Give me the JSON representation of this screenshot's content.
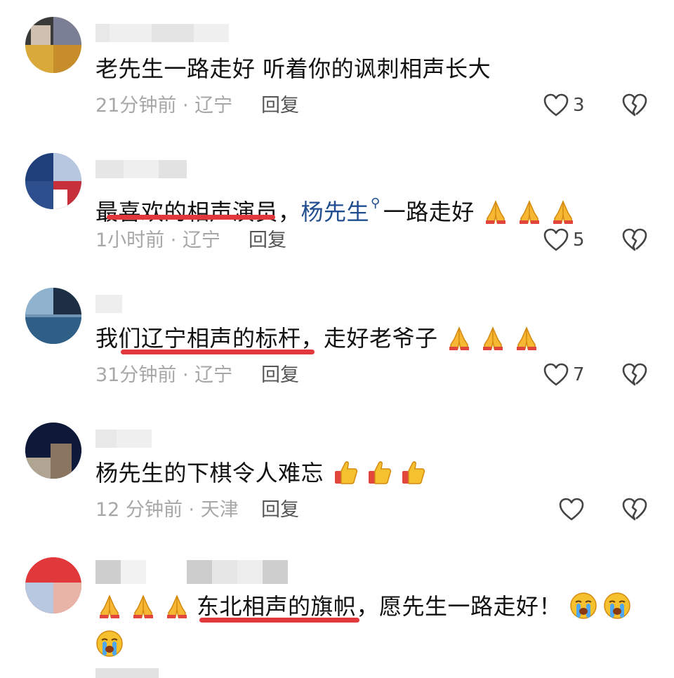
{
  "comments": [
    {
      "text": "老先生一路走好  听着你的讽刺相声长大",
      "time": "21分钟前",
      "location": "辽宁",
      "reply_label": "回复",
      "likes": "3"
    },
    {
      "text_before": "最喜欢的相声演员，",
      "link_text": "杨先生",
      "text_after": "一路走好",
      "time": "1小时前",
      "location": "辽宁",
      "reply_label": "回复",
      "likes": "5",
      "emoji": [
        "folded-hands",
        "folded-hands",
        "folded-hands"
      ]
    },
    {
      "text": "我们辽宁相声的标杆，走好老爷子",
      "time": "31分钟前",
      "location": "辽宁",
      "reply_label": "回复",
      "likes": "7",
      "emoji": [
        "folded-hands",
        "folded-hands",
        "folded-hands"
      ]
    },
    {
      "text": "杨先生的下棋令人难忘",
      "time": "12 分钟前",
      "location": "天津",
      "reply_label": "回复",
      "likes": "",
      "emoji": [
        "thumbs-up",
        "thumbs-up",
        "thumbs-up"
      ]
    },
    {
      "text": "东北相声的旗帜，愿先生一路走好！",
      "emoji_before": [
        "folded-hands",
        "folded-hands",
        "folded-hands"
      ],
      "emoji_after": [
        "crying-face",
        "crying-face",
        "crying-face"
      ]
    }
  ],
  "separator": " · ",
  "colors": {
    "underline": "#e0383b",
    "link": "#1f4d8f",
    "meta": "#a7a7a7"
  },
  "icons": {
    "like": "heart-outline-icon",
    "dislike": "broken-heart-icon"
  }
}
